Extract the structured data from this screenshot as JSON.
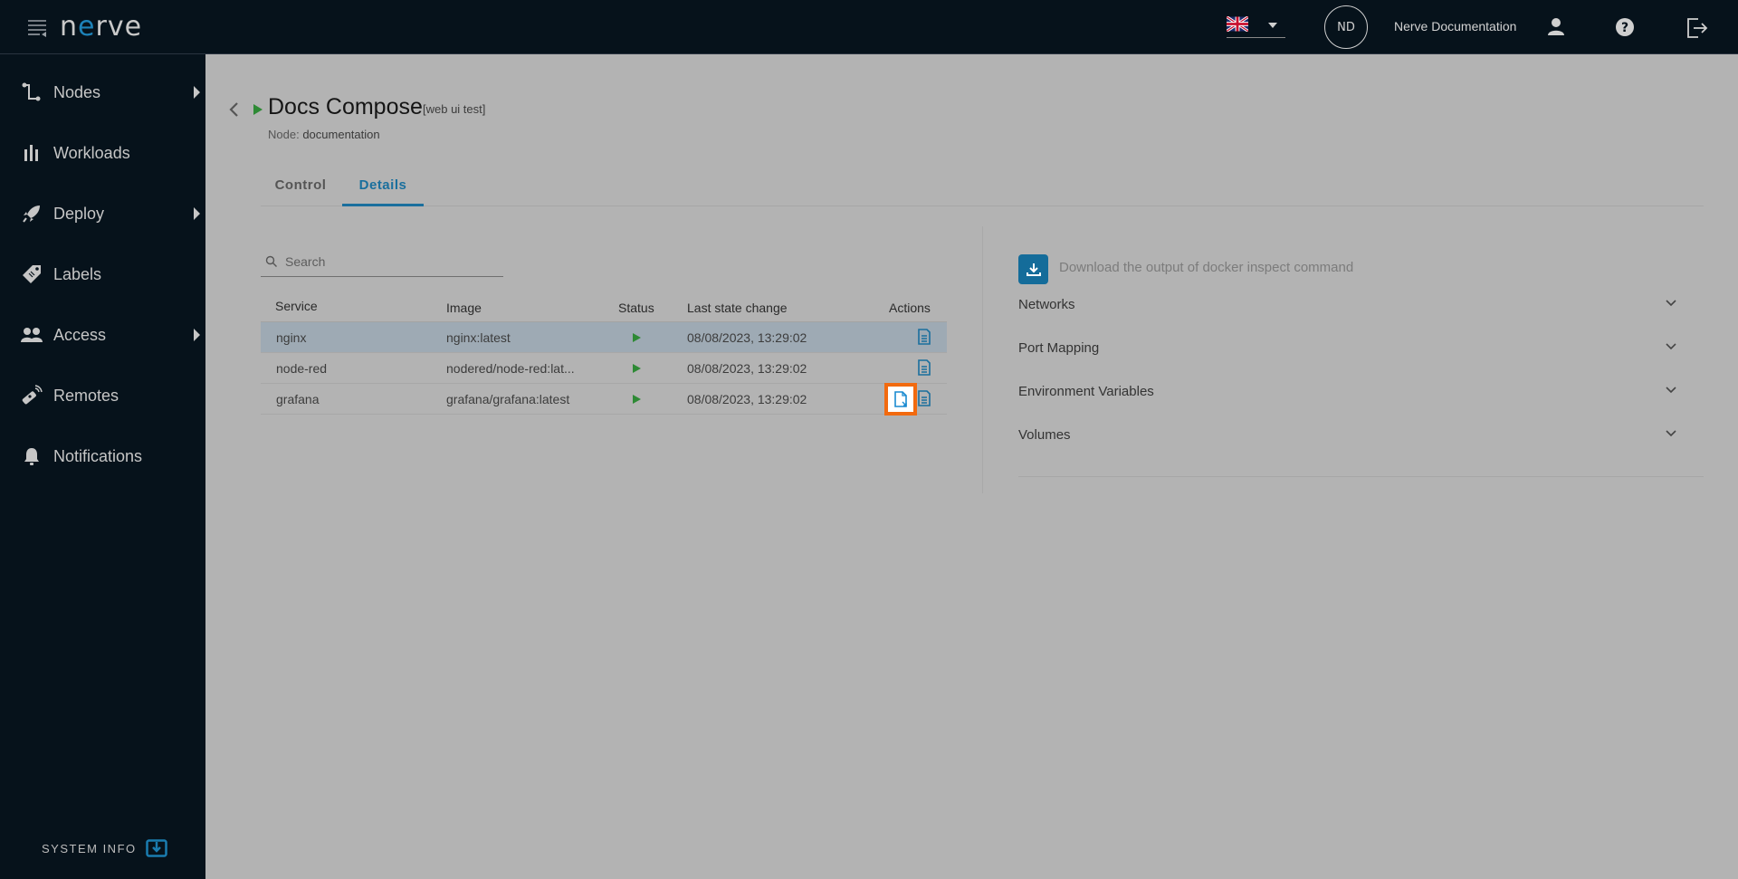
{
  "header": {
    "logo_prefix": "n",
    "logo_accent": "e",
    "logo_suffix": "rve",
    "language": "English (UK)",
    "avatar_initials": "ND",
    "user_name": "Nerve Documentation",
    "icons": [
      "menu-toggle-icon",
      "uk-flag-icon",
      "user-icon",
      "help-icon",
      "logout-icon"
    ]
  },
  "sidebar": {
    "items": [
      {
        "label": "Nodes",
        "icon": "nodes-icon",
        "has_submenu": true
      },
      {
        "label": "Workloads",
        "icon": "workloads-icon",
        "has_submenu": false
      },
      {
        "label": "Deploy",
        "icon": "rocket-icon",
        "has_submenu": true
      },
      {
        "label": "Labels",
        "icon": "tag-icon",
        "has_submenu": false
      },
      {
        "label": "Access",
        "icon": "users-icon",
        "has_submenu": true
      },
      {
        "label": "Remotes",
        "icon": "remote-icon",
        "has_submenu": false
      },
      {
        "label": "Notifications",
        "icon": "bell-icon",
        "has_submenu": false
      }
    ],
    "system_info_label": "SYSTEM INFO"
  },
  "page": {
    "title": "Docs Compose",
    "tag": "[web ui test]",
    "node_label": "Node:",
    "node_value": "documentation",
    "tabs": [
      {
        "label": "Control",
        "active": false
      },
      {
        "label": "Details",
        "active": true
      }
    ]
  },
  "services": {
    "search_placeholder": "Search",
    "search_value": "",
    "columns": [
      "Service",
      "Image",
      "Status",
      "Last state change",
      "Actions"
    ],
    "rows": [
      {
        "service": "nginx",
        "image": "nginx:latest",
        "status": "running",
        "last_change": "08/08/2023, 13:29:02",
        "selected": true,
        "actions": [
          "logs"
        ]
      },
      {
        "service": "node-red",
        "image": "nodered/node-red:lat...",
        "status": "running",
        "last_change": "08/08/2023, 13:29:02",
        "selected": false,
        "actions": [
          "logs"
        ]
      },
      {
        "service": "grafana",
        "image": "grafana/grafana:latest",
        "status": "running",
        "last_change": "08/08/2023, 13:29:02",
        "selected": false,
        "actions": [
          "export-file",
          "logs"
        ]
      }
    ]
  },
  "details": {
    "download_label": "Download the output of docker inspect command",
    "sections": [
      {
        "label": "Networks",
        "expanded": false
      },
      {
        "label": "Port Mapping",
        "expanded": false
      },
      {
        "label": "Environment Variables",
        "expanded": false
      },
      {
        "label": "Volumes",
        "expanded": false
      }
    ]
  },
  "colors": {
    "accent": "#1a6f9d",
    "running": "#2e8a35",
    "highlight": "#f26a0f",
    "header_bg": "#06121b"
  }
}
